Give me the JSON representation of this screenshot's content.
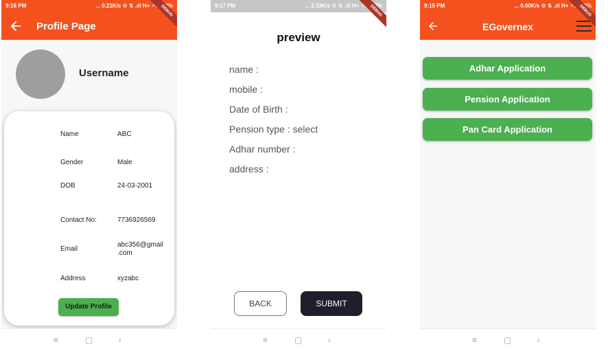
{
  "profile_page": {
    "status": {
      "time": "9:16 PM",
      "info": "... 0.21K/s ⚙ ⇅ .ıll H+ ⚡▭ 13%"
    },
    "debug": "DEBUG",
    "title": "Profile Page",
    "username": "Username",
    "rows": [
      {
        "label": "Name",
        "value": "ABC"
      },
      {
        "label": "Gender",
        "value": "Male"
      },
      {
        "label": "DOB",
        "value": "24-03-2001"
      },
      {
        "label": "Contact No:",
        "value": "7736926569"
      },
      {
        "label": "Email",
        "value": "abc356@gmail\n.com"
      },
      {
        "label": "Address",
        "value": "xyzabc"
      }
    ],
    "update_button": "Update Profile",
    "nav": {
      "menu": "≡",
      "home": "▢",
      "back": "‹"
    }
  },
  "preview_page": {
    "status": {
      "time": "9:17 PM",
      "info": "... 2.33K/s ⚙ ⇅ .ıll H+ ⚡▭ 13%"
    },
    "debug": "DEBUG",
    "title": "preview",
    "fields": [
      "name  :",
      "mobile  :",
      "Date of Birth  :",
      "Pension type  :  select",
      "Adhar number  :",
      "address  :"
    ],
    "back_button": "BACK",
    "submit_button": "SUBMIT",
    "nav": {
      "menu": "≡",
      "home": "▢",
      "back": "‹"
    }
  },
  "egovernex_page": {
    "status": {
      "time": "9:15 PM",
      "info": "... 0.00K/s ⚙ ⇅ .ıll H+ ⚡▭ 13%"
    },
    "debug": "DEBUG",
    "title": "EGovernex",
    "buttons": [
      "Adhar Application",
      "Pension Application",
      "Pan Card Application"
    ],
    "nav": {
      "menu": "≡",
      "home": "▢",
      "back": "‹"
    }
  },
  "colors": {
    "app_bar": "#f4511e",
    "green_button": "#4caf50",
    "dark_button": "#1e1e2c"
  }
}
